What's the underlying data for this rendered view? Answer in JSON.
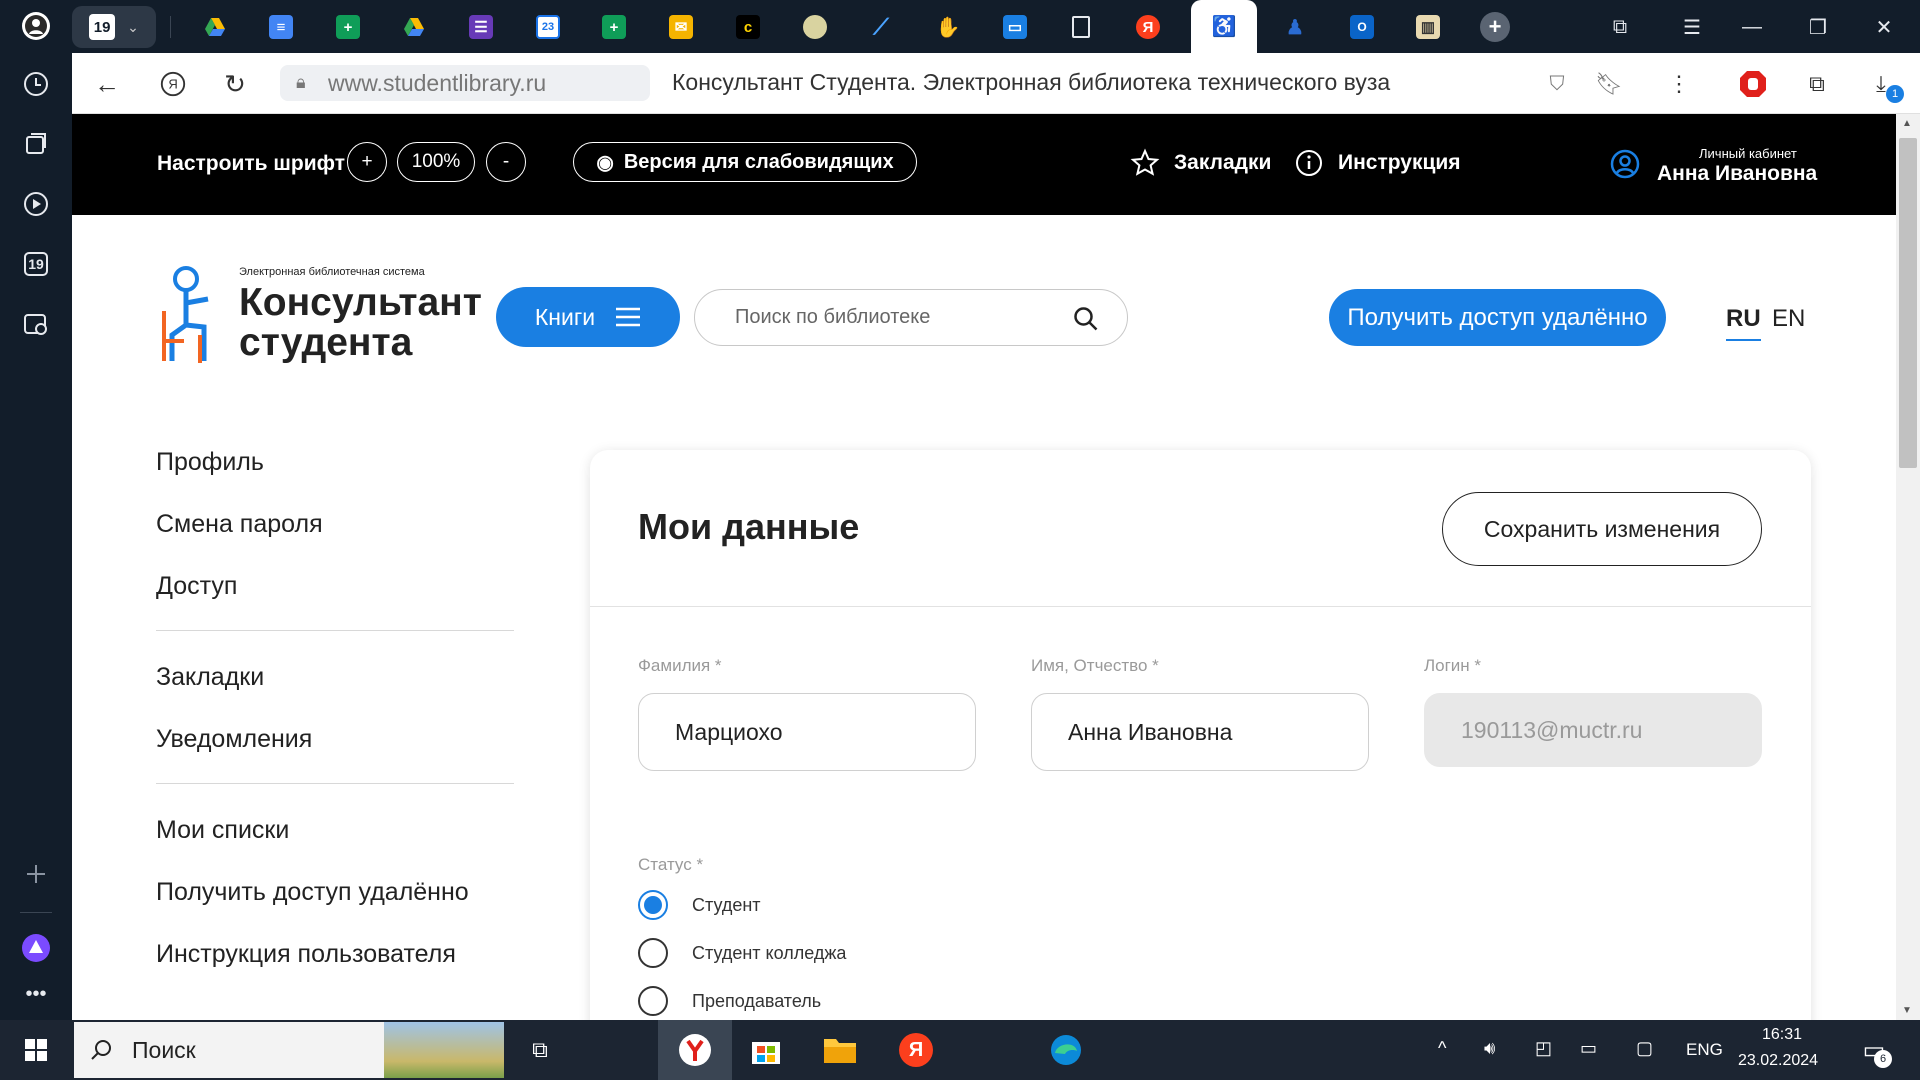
{
  "browser": {
    "tab_badge": "19",
    "url": "www.studentlibrary.ru",
    "page_title": "Консультант Студента. Электронная библиотека технического вуза",
    "download_badge": "1",
    "sidebar_badge": "19"
  },
  "topstrip": {
    "font_label": "Настроить шрифт",
    "plus": "+",
    "zoom": "100%",
    "minus": "-",
    "low_vision": "Версия для слабовидящих",
    "bookmarks": "Закладки",
    "instructions": "Инструкция",
    "cabinet_label": "Личный кабинет",
    "user_name": "Анна Ивановна"
  },
  "header": {
    "logo_sub": "Электронная библиотечная система",
    "logo_line1": "Консультант",
    "logo_line2": "студента",
    "books_button": "Книги",
    "search_placeholder": "Поиск по библиотеке",
    "remote_button": "Получить доступ удалённо",
    "lang_ru": "RU",
    "lang_en": "EN"
  },
  "leftnav": {
    "group1": [
      "Профиль",
      "Смена пароля",
      "Доступ"
    ],
    "group2": [
      "Закладки",
      "Уведомления"
    ],
    "group3": [
      "Мои списки",
      "Получить доступ удалённо",
      "Инструкция пользователя"
    ]
  },
  "card": {
    "title": "Мои данные",
    "save_button": "Сохранить изменения",
    "fields": {
      "surname_label": "Фамилия *",
      "surname_value": "Марциохо",
      "name_label": "Имя, Отчество *",
      "name_value": "Анна Ивановна",
      "login_label": "Логин *",
      "login_value": "190113@muctr.ru"
    },
    "status_label": "Статус *",
    "status_options": [
      "Студент",
      "Студент колледжа",
      "Преподаватель"
    ],
    "status_selected": "Студент"
  },
  "taskbar": {
    "search": "Поиск",
    "lang": "ENG",
    "time": "16:31",
    "date": "23.02.2024",
    "notif_count": "6"
  },
  "colors": {
    "accent": "#1a7fe2",
    "topstrip_bg": "#000000",
    "browser_chrome": "#121d2a"
  }
}
